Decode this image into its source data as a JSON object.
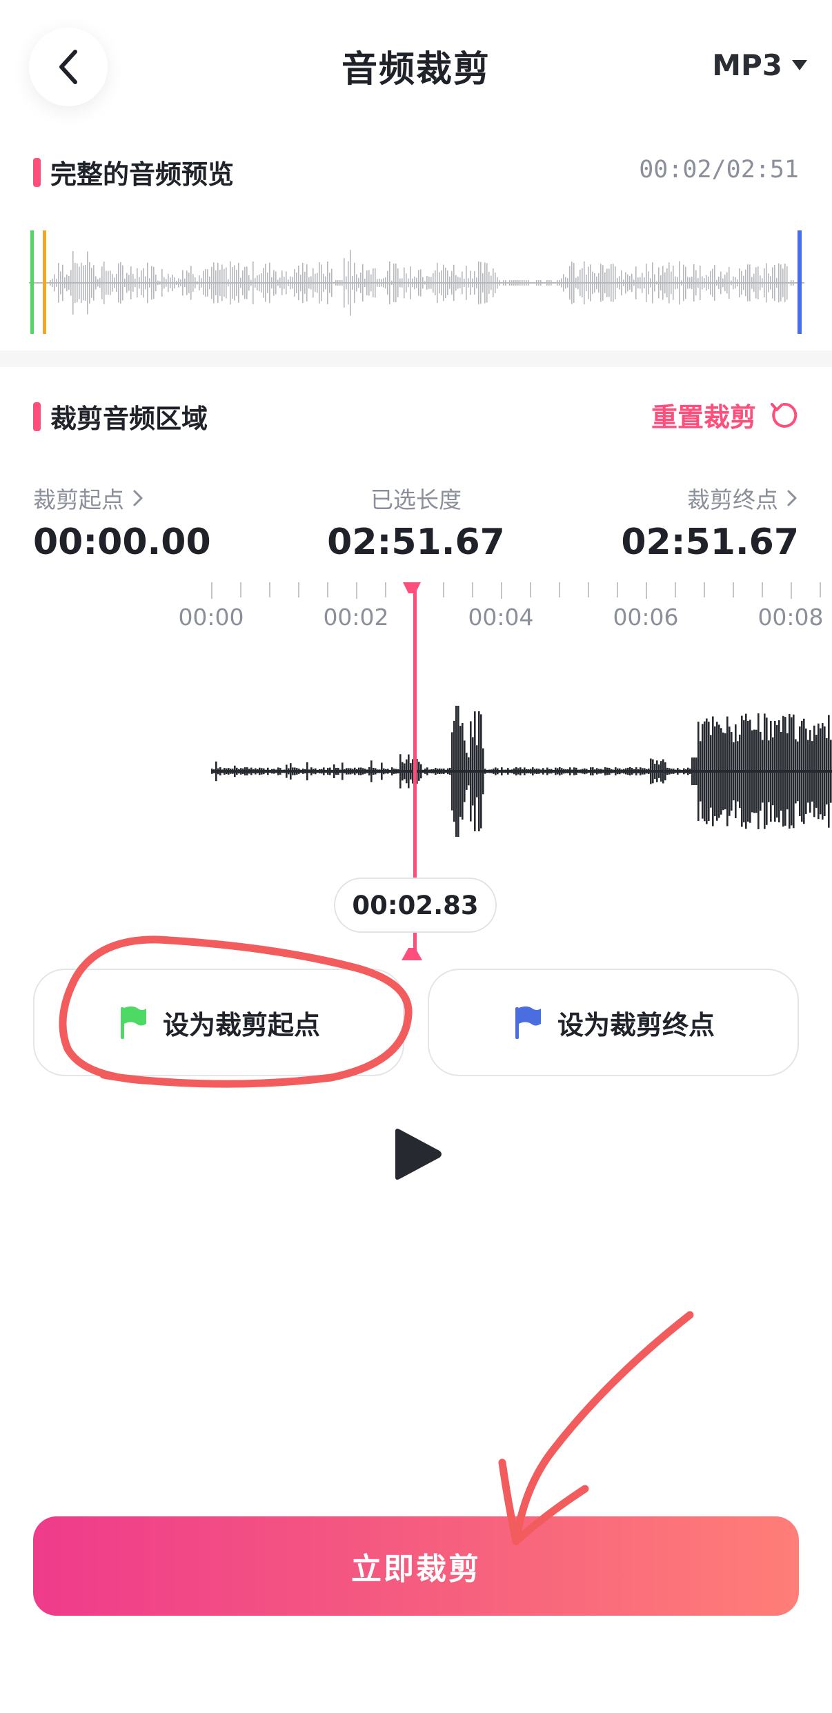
{
  "header": {
    "title": "音频裁剪",
    "format": "MP3"
  },
  "preview": {
    "title": "完整的音频预览",
    "time": "00:02/02:51"
  },
  "crop": {
    "title": "裁剪音频区域",
    "reset_label": "重置裁剪",
    "start_label": "裁剪起点",
    "start_value": "00:00.00",
    "length_label": "已选长度",
    "length_value": "02:51.67",
    "end_label": "裁剪终点",
    "end_value": "02:51.67"
  },
  "timeline": {
    "ticks": [
      "00:00",
      "00:02",
      "00:04",
      "00:06",
      "00:08"
    ],
    "playhead_time": "00:02.83"
  },
  "buttons": {
    "set_start": "设为裁剪起点",
    "set_end": "设为裁剪终点",
    "cut_now": "立即裁剪"
  },
  "colors": {
    "accent": "#ff4d7c",
    "start_flag": "#4cd964",
    "end_flag": "#4a6ee0",
    "annotation": "#f25c5c"
  },
  "icons": {
    "back": "chevron-left-icon",
    "dropdown": "caret-down-icon",
    "reset": "refresh-icon",
    "play": "play-icon"
  }
}
